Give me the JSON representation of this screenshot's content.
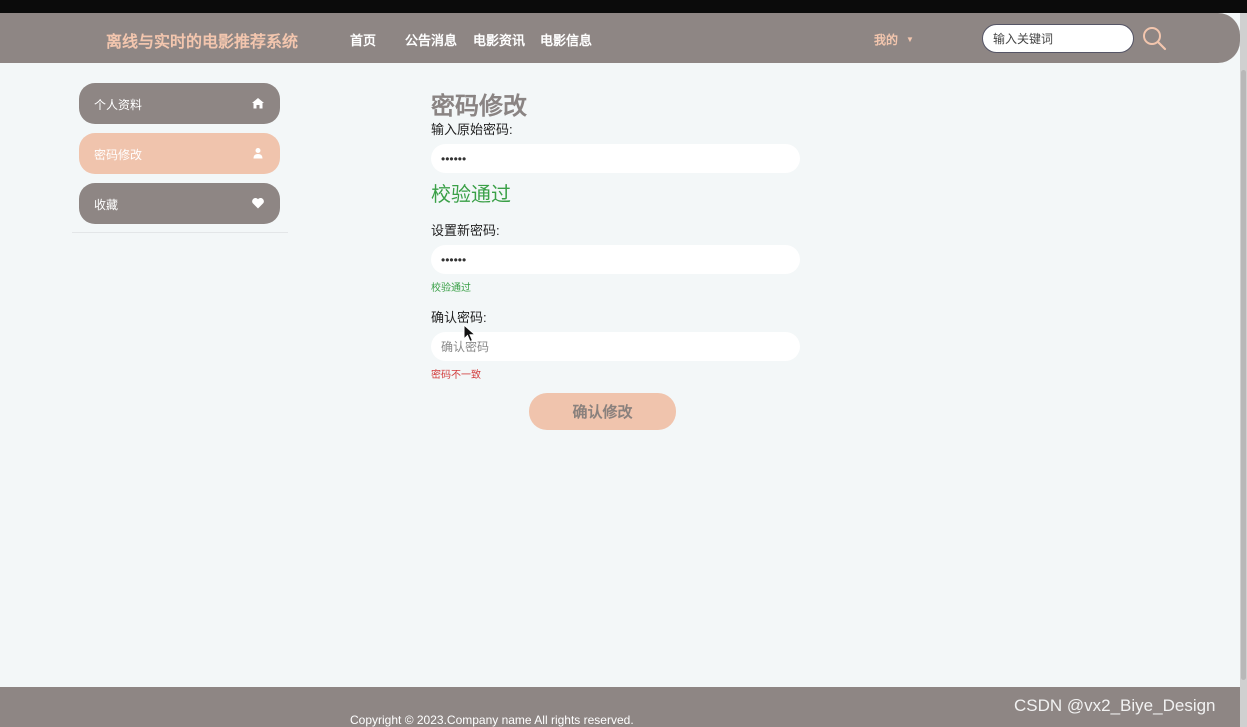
{
  "header": {
    "brand": "离线与实时的电影推荐系统",
    "nav": [
      "首页",
      "公告消息",
      "电影资讯",
      "电影信息"
    ],
    "me": "我的",
    "search_placeholder": "输入关键词"
  },
  "sidebar": {
    "items": [
      {
        "label": "个人资料",
        "icon": "home-icon"
      },
      {
        "label": "密码修改",
        "icon": "user-icon",
        "active": true
      },
      {
        "label": "收藏",
        "icon": "heart-icon"
      }
    ]
  },
  "form": {
    "title": "密码修改",
    "old_label": "输入原始密码:",
    "old_value": "••••••",
    "old_status": "校验通过",
    "new_label": "设置新密码:",
    "new_value": "••••••",
    "new_status": "校验通过",
    "confirm_label": "确认密码:",
    "confirm_placeholder": "确认密码",
    "confirm_status": "密码不一致",
    "submit": "确认修改"
  },
  "footer": {
    "copyright": "Copyright © 2023.Company name All rights reserved."
  },
  "watermark": "CSDN @vx2_Biye_Design",
  "colors": {
    "nav_bg": "#8e8684",
    "accent": "#f0c4ad",
    "success": "#3aa047",
    "error": "#d23c3c",
    "page_bg": "#f3f7f8"
  }
}
